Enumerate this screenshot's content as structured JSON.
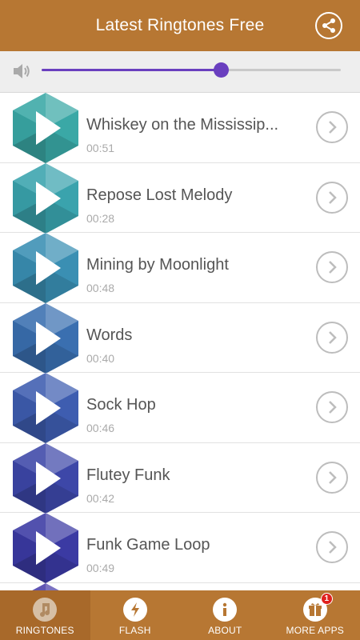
{
  "header": {
    "title": "Latest Ringtones Free",
    "share_icon": "share-icon"
  },
  "volume": {
    "level_percent": 60,
    "icon": "speaker-icon",
    "accent": "#6a3fbf"
  },
  "ringtones": [
    {
      "title": "Whiskey on the Mississip...",
      "duration": "00:51",
      "color": "#3aa8a6",
      "dark": "#227a79"
    },
    {
      "title": "Repose Lost Melody",
      "duration": "00:28",
      "color": "#3aa3ad",
      "dark": "#23767f"
    },
    {
      "title": "Mining by Moonlight",
      "duration": "00:48",
      "color": "#3a8fb3",
      "dark": "#246688"
    },
    {
      "title": "Words",
      "duration": "00:40",
      "color": "#3a6fb0",
      "dark": "#244e87"
    },
    {
      "title": "Sock Hop",
      "duration": "00:46",
      "color": "#3e5db0",
      "dark": "#263f88"
    },
    {
      "title": "Flutey Funk",
      "duration": "00:42",
      "color": "#3d47a8",
      "dark": "#262d80"
    },
    {
      "title": "Funk Game Loop",
      "duration": "00:49",
      "color": "#3b3aa3",
      "dark": "#25247c"
    },
    {
      "title": "",
      "duration": "",
      "color": "#4a3ea8",
      "dark": "#2e2680"
    }
  ],
  "bottom_nav": [
    {
      "label": "RINGTONES",
      "icon": "music-note-icon",
      "active": true
    },
    {
      "label": "FLASH",
      "icon": "lightning-icon",
      "active": false
    },
    {
      "label": "ABOUT",
      "icon": "info-icon",
      "active": false
    },
    {
      "label": "MORE APPS",
      "icon": "gift-icon",
      "active": false,
      "badge": "1"
    }
  ],
  "colors": {
    "primary": "#b77733",
    "primary_dark": "#a8692a"
  }
}
